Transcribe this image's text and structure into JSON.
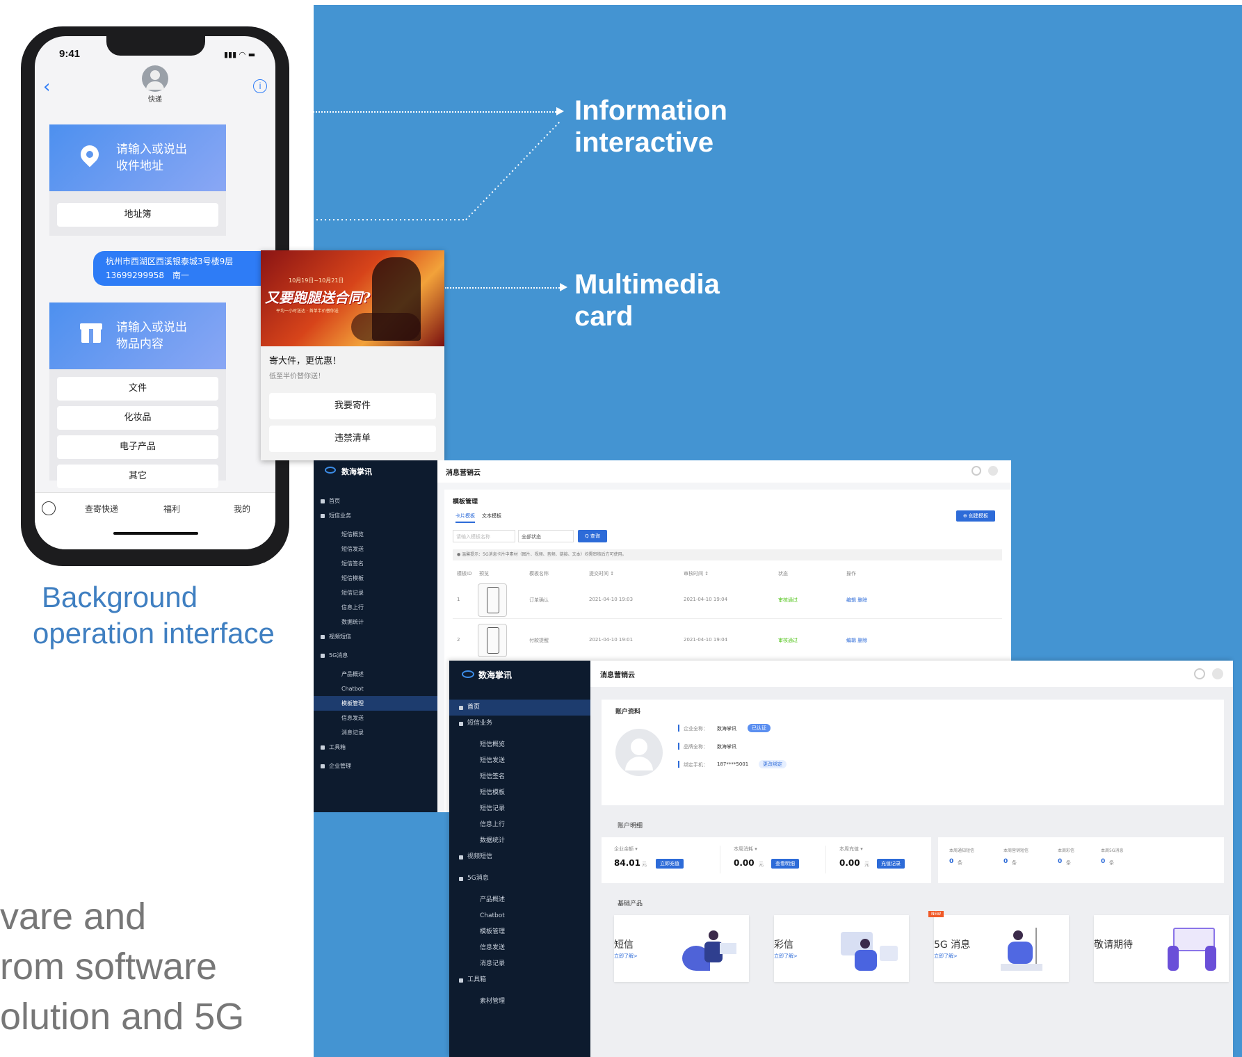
{
  "callouts": {
    "info_line1": "Information",
    "info_line2": "interactive",
    "media_line1": "Multimedia",
    "media_line2": "card"
  },
  "labels": {
    "background_line1": "Background",
    "background_line2": "operation interface",
    "cut_line1": "vare and",
    "cut_line2": "rom software",
    "cut_line3": "olution and 5G"
  },
  "phone": {
    "time": "9:41",
    "contact": "快递",
    "card1_text_line1": "请输入或说出",
    "card1_text_line2": "收件地址",
    "address_book": "地址簿",
    "bubble_line1": "杭州市西湖区西溪银泰城3号楼9层",
    "bubble_line2": "13699299958　南一",
    "card2_text_line1": "请输入或说出",
    "card2_text_line2": "物品内容",
    "options": [
      "文件",
      "化妆品",
      "电子产品",
      "其它"
    ],
    "bottom_nav": [
      "查寄快递",
      "福利",
      "我的"
    ]
  },
  "media_card": {
    "banner_date": "10月19日~10月21日",
    "banner_slogan": "又要跑腿送合同?",
    "banner_sub": "平均一小时送达 · 首单半价替你送",
    "title": "寄大件，更优惠！",
    "subtitle": "低至半价替你送！",
    "button1": "我要寄件",
    "button2": "违禁清单"
  },
  "dashboard1": {
    "brand": "数海掌讯",
    "topbar_title": "消息营销云",
    "section_title": "模板管理",
    "tabs": [
      "卡片模板",
      "文本模板"
    ],
    "create_button": "⊕ 创建模板",
    "search_placeholder": "请输入模板名称",
    "status_select": "全部状态",
    "search_button": "Q 查询",
    "notice": "● 温馨提示：5G消息卡片中素材（图片、视频、音频、链接、文本）均需审核后方可使用。",
    "columns": [
      "模板ID",
      "预览",
      "模板名称",
      "提交时间 ↕",
      "审核时间 ↕",
      "状态",
      "操作"
    ],
    "rows": [
      {
        "id": "1",
        "name": "订单确认",
        "submit": "2021-04-10 19:03",
        "review": "2021-04-10 19:04",
        "status": "审核通过",
        "ops": "编辑  删除"
      },
      {
        "id": "2",
        "name": "付款提醒",
        "submit": "2021-04-10 19:01",
        "review": "2021-04-10 19:04",
        "status": "审核通过",
        "ops": "编辑  删除"
      }
    ],
    "sidebar": [
      {
        "label": "首页",
        "level": 0,
        "icon": "home"
      },
      {
        "label": "短信业务",
        "level": 0,
        "icon": "sms"
      },
      {
        "label": "短信概览",
        "level": 1
      },
      {
        "label": "短信发送",
        "level": 1
      },
      {
        "label": "短信签名",
        "level": 1
      },
      {
        "label": "短信模板",
        "level": 1
      },
      {
        "label": "短信记录",
        "level": 1
      },
      {
        "label": "信息上行",
        "level": 1
      },
      {
        "label": "数据统计",
        "level": 1
      },
      {
        "label": "视频短信",
        "level": 0,
        "icon": "video"
      },
      {
        "label": "5G消息",
        "level": 0,
        "icon": "5g"
      },
      {
        "label": "产品概述",
        "level": 1
      },
      {
        "label": "Chatbot",
        "level": 1
      },
      {
        "label": "模板管理",
        "level": 1,
        "active": true
      },
      {
        "label": "信息发送",
        "level": 1
      },
      {
        "label": "消息记录",
        "level": 1
      },
      {
        "label": "工具箱",
        "level": 0,
        "icon": "tool"
      },
      {
        "label": "企业管理",
        "level": 0,
        "icon": "user"
      }
    ]
  },
  "dashboard2": {
    "brand": "数海掌讯",
    "topbar_title": "消息营销云",
    "account_title": "账户资料",
    "company_label": "企业全称：",
    "company_value": "数海掌讯",
    "company_badge": "已认证",
    "brand_label": "品牌全称：",
    "brand_value": "数海掌讯",
    "phone_label": "绑定手机：",
    "phone_value": "187****5001",
    "phone_badge": "更改绑定",
    "detail_title": "账户明细",
    "balance": {
      "label": "企业余额 ▾",
      "value": "84.01",
      "unit": "元",
      "button": "立即充值"
    },
    "consume": {
      "label": "本周消耗 ▾",
      "value": "0.00",
      "unit": "元",
      "button": "查看明细"
    },
    "recharge": {
      "label": "本周充值 ▾",
      "value": "0.00",
      "unit": "元",
      "button": "充值记录"
    },
    "stats": [
      {
        "label": "本周通知短信",
        "value": "0",
        "unit": "条"
      },
      {
        "label": "本周营销短信",
        "value": "0",
        "unit": "条"
      },
      {
        "label": "本周彩信",
        "value": "0",
        "unit": "条"
      },
      {
        "label": "本周5G消息",
        "value": "0",
        "unit": "条"
      }
    ],
    "products_title": "基础产品",
    "products": [
      {
        "name": "短信",
        "link": "立即了解>"
      },
      {
        "name": "彩信",
        "link": "立即了解>"
      },
      {
        "name": "5G 消息",
        "link": "立即了解>",
        "badge": "NEW"
      },
      {
        "name": "敬请期待",
        "link": ""
      }
    ],
    "sidebar": [
      {
        "label": "首页",
        "level": 0,
        "active": true
      },
      {
        "label": "短信业务",
        "level": 0
      },
      {
        "label": "短信概览",
        "level": 1
      },
      {
        "label": "短信发送",
        "level": 1
      },
      {
        "label": "短信签名",
        "level": 1
      },
      {
        "label": "短信模板",
        "level": 1
      },
      {
        "label": "短信记录",
        "level": 1
      },
      {
        "label": "信息上行",
        "level": 1
      },
      {
        "label": "数据统计",
        "level": 1
      },
      {
        "label": "视频短信",
        "level": 0
      },
      {
        "label": "5G消息",
        "level": 0
      },
      {
        "label": "产品概述",
        "level": 1
      },
      {
        "label": "Chatbot",
        "level": 1
      },
      {
        "label": "模板管理",
        "level": 1
      },
      {
        "label": "信息发送",
        "level": 1
      },
      {
        "label": "消息记录",
        "level": 1
      },
      {
        "label": "工具箱",
        "level": 0
      },
      {
        "label": "素材管理",
        "level": 1
      }
    ]
  },
  "colors": {
    "panel_blue": "#4494d2",
    "sidebar_dark": "#0d1b2e",
    "accent": "#2d6bd8",
    "success": "#52c41a"
  }
}
